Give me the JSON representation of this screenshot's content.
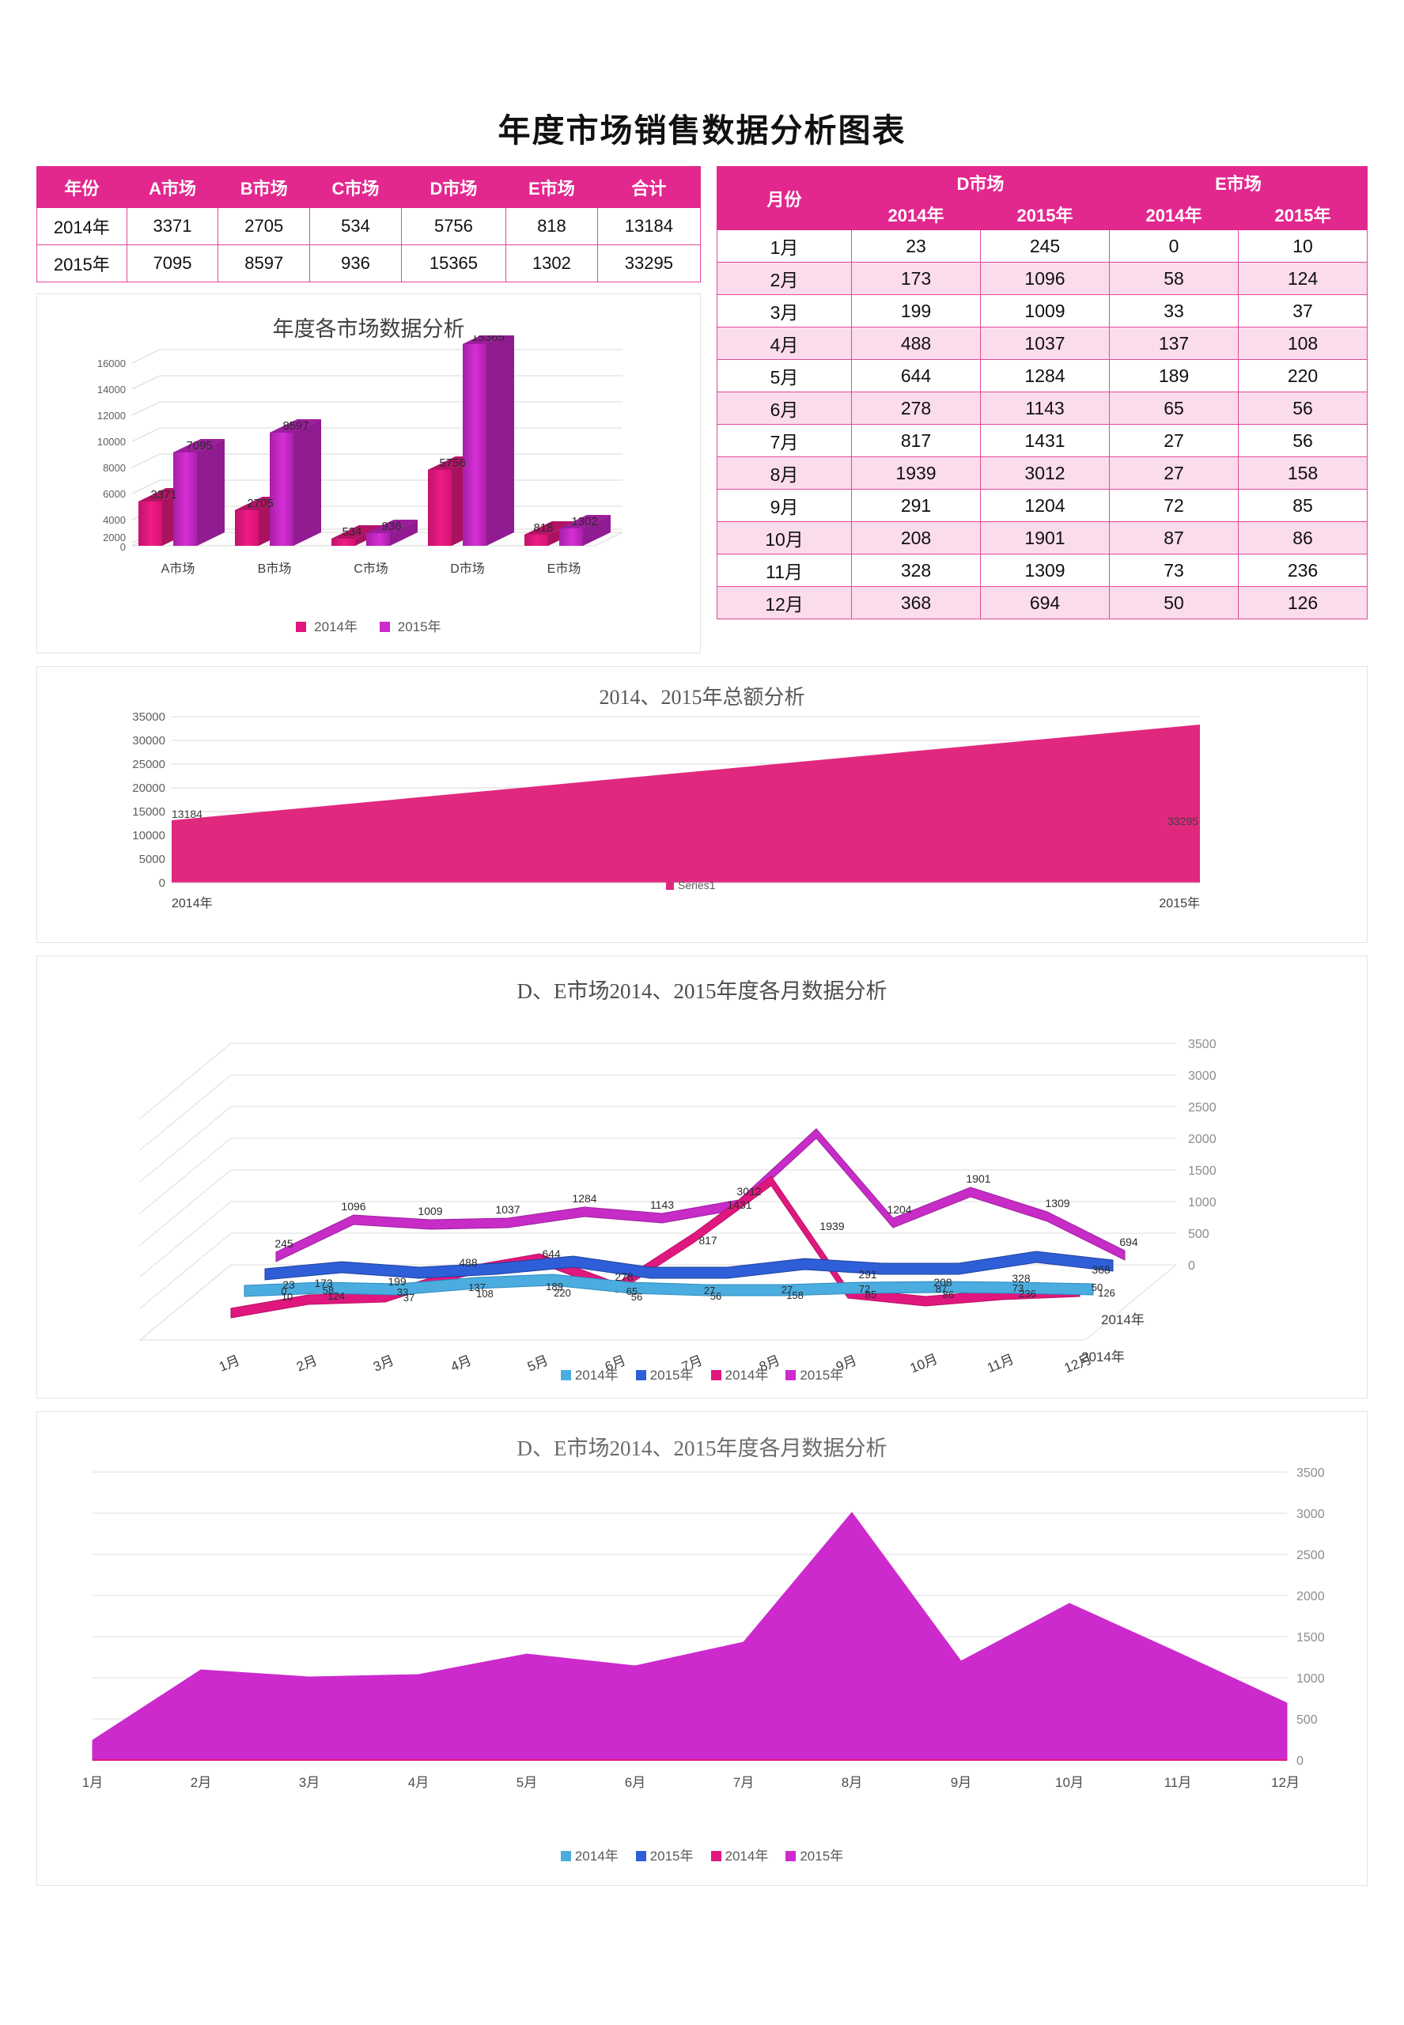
{
  "title": "年度市场销售数据分析图表",
  "annual_table": {
    "headers": [
      "年份",
      "A市场",
      "B市场",
      "C市场",
      "D市场",
      "E市场",
      "合计"
    ],
    "rows": [
      {
        "year": "2014年",
        "a": "3371",
        "b": "2705",
        "c": "534",
        "d": "5756",
        "e": "818",
        "total": "13184"
      },
      {
        "year": "2015年",
        "a": "7095",
        "b": "8597",
        "c": "936",
        "d": "15365",
        "e": "1302",
        "total": "33295"
      }
    ]
  },
  "monthly_table": {
    "group_headers": [
      "D市场",
      "E市场"
    ],
    "sub_headers": [
      "月份",
      "2014年",
      "2015年",
      "2014年",
      "2015年"
    ],
    "rows": [
      {
        "month": "1月",
        "d2014": "23",
        "d2015": "245",
        "e2014": "0",
        "e2015": "10"
      },
      {
        "month": "2月",
        "d2014": "173",
        "d2015": "1096",
        "e2014": "58",
        "e2015": "124"
      },
      {
        "month": "3月",
        "d2014": "199",
        "d2015": "1009",
        "e2014": "33",
        "e2015": "37"
      },
      {
        "month": "4月",
        "d2014": "488",
        "d2015": "1037",
        "e2014": "137",
        "e2015": "108"
      },
      {
        "month": "5月",
        "d2014": "644",
        "d2015": "1284",
        "e2014": "189",
        "e2015": "220"
      },
      {
        "month": "6月",
        "d2014": "278",
        "d2015": "1143",
        "e2014": "65",
        "e2015": "56"
      },
      {
        "month": "7月",
        "d2014": "817",
        "d2015": "1431",
        "e2014": "27",
        "e2015": "56"
      },
      {
        "month": "8月",
        "d2014": "1939",
        "d2015": "3012",
        "e2014": "27",
        "e2015": "158"
      },
      {
        "month": "9月",
        "d2014": "291",
        "d2015": "1204",
        "e2014": "72",
        "e2015": "85"
      },
      {
        "month": "10月",
        "d2014": "208",
        "d2015": "1901",
        "e2014": "87",
        "e2015": "86"
      },
      {
        "month": "11月",
        "d2014": "328",
        "d2015": "1309",
        "e2014": "73",
        "e2015": "236"
      },
      {
        "month": "12月",
        "d2014": "368",
        "d2015": "694",
        "e2014": "50",
        "e2015": "126"
      }
    ]
  },
  "colors": {
    "header_pink": "#E2288E",
    "border_pink": "#E4489B",
    "alt_row": "#FBDCEC",
    "series_2014_pink": "#E0177E",
    "series_2015_purple": "#CC2ACC",
    "series_2014_lightblue": "#4BACDF",
    "series_2015_blue": "#2E5FD8",
    "area_pink": "#E1287F",
    "grid": "#D9D9D9"
  },
  "chart_data": [
    {
      "id": "bar_chart",
      "type": "bar",
      "title": "年度各市场数据分析",
      "categories": [
        "A市场",
        "B市场",
        "C市场",
        "D市场",
        "E市场"
      ],
      "series": [
        {
          "name": "2014年",
          "color": "#E0177E",
          "values": [
            3371,
            2705,
            534,
            5756,
            818
          ]
        },
        {
          "name": "2015年",
          "color": "#CC2ACC",
          "values": [
            7095,
            8597,
            936,
            15365,
            1302
          ]
        }
      ],
      "ylim": [
        0,
        16000
      ],
      "yticks": [
        0,
        2000,
        4000,
        6000,
        8000,
        10000,
        12000,
        14000,
        16000
      ],
      "xlabel": "",
      "ylabel": "",
      "grid": true,
      "legend": "bottom",
      "data_labels": true
    },
    {
      "id": "total_area_chart",
      "type": "area",
      "title": "2014、2015年总额分析",
      "categories": [
        "2014年",
        "2015年"
      ],
      "series": [
        {
          "name": "Series1",
          "color": "#E1287F",
          "values": [
            13184,
            33295
          ]
        }
      ],
      "ylim": [
        0,
        35000
      ],
      "yticks": [
        0,
        5000,
        10000,
        15000,
        20000,
        25000,
        30000,
        35000
      ],
      "grid": true,
      "legend": "bottom",
      "data_labels": true
    },
    {
      "id": "area3d_chart",
      "type": "area",
      "title": "D、E市场2014、2015年度各月数据分析",
      "categories": [
        "1月",
        "2月",
        "3月",
        "4月",
        "5月",
        "6月",
        "7月",
        "8月",
        "9月",
        "10月",
        "11月",
        "12月"
      ],
      "depth_labels": [
        "2014年",
        "2014年"
      ],
      "series": [
        {
          "name": "2014年",
          "color": "#4BACDF",
          "values": [
            0,
            58,
            33,
            137,
            189,
            65,
            27,
            27,
            72,
            87,
            73,
            50
          ]
        },
        {
          "name": "2015年",
          "color": "#2E5FD8",
          "values": [
            10,
            124,
            37,
            108,
            220,
            56,
            56,
            158,
            85,
            86,
            236,
            126
          ]
        },
        {
          "name": "2014年",
          "color": "#E0177E",
          "values": [
            23,
            173,
            199,
            488,
            644,
            278,
            817,
            1939,
            291,
            208,
            328,
            368
          ]
        },
        {
          "name": "2015年",
          "color": "#CC2ACC",
          "values": [
            245,
            1096,
            1009,
            1037,
            1284,
            1143,
            1431,
            3012,
            1204,
            1901,
            1309,
            694
          ]
        }
      ],
      "ylim": [
        0,
        3500
      ],
      "yticks": [
        0,
        500,
        1000,
        1500,
        2000,
        2500,
        3000,
        3500
      ],
      "grid": true,
      "legend": "bottom",
      "data_labels": true
    },
    {
      "id": "area2d_chart",
      "type": "area",
      "title": "D、E市场2014、2015年度各月数据分析",
      "categories": [
        "1月",
        "2月",
        "3月",
        "4月",
        "5月",
        "6月",
        "7月",
        "8月",
        "9月",
        "10月",
        "11月",
        "12月"
      ],
      "series": [
        {
          "name": "2014年",
          "color": "#4BACDF",
          "values": []
        },
        {
          "name": "2015年",
          "color": "#2E5FD8",
          "values": []
        },
        {
          "name": "2014年",
          "color": "#E0177E",
          "values": []
        },
        {
          "name": "2015年",
          "color": "#CC2ACC",
          "values": [
            245,
            1096,
            1009,
            1037,
            1284,
            1143,
            1431,
            3012,
            1204,
            1901,
            1309,
            694
          ]
        }
      ],
      "ylim": [
        0,
        3500
      ],
      "yticks": [
        0,
        500,
        1000,
        1500,
        2000,
        2500,
        3000,
        3500
      ],
      "grid": true,
      "legend": "bottom",
      "data_labels": false
    }
  ],
  "legends": {
    "bar": [
      "2014年",
      "2015年"
    ],
    "total": [
      "Series1"
    ],
    "monthly": [
      "2014年",
      "2015年",
      "2014年",
      "2015年"
    ]
  }
}
